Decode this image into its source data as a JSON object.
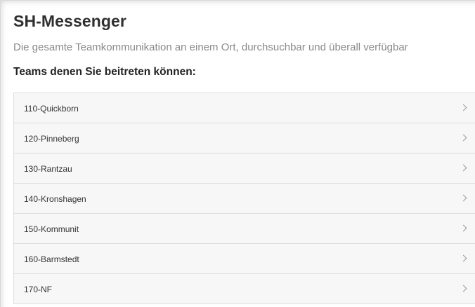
{
  "app": {
    "title": "SH-Messenger",
    "subtitle": "Die gesamte Teamkommunikation an einem Ort, durchsuchbar und überall verfügbar"
  },
  "teams_section": {
    "heading": "Teams denen Sie beitreten können:",
    "items": [
      {
        "label": "110-Quickborn",
        "icon": "chevron-right-icon"
      },
      {
        "label": "120-Pinneberg",
        "icon": "chevron-right-icon"
      },
      {
        "label": "130-Rantzau",
        "icon": "chevron-right-icon"
      },
      {
        "label": "140-Kronshagen",
        "icon": "chevron-right-icon"
      },
      {
        "label": "150-Kommunit",
        "icon": "chevron-right-icon"
      },
      {
        "label": "160-Barmstedt",
        "icon": "chevron-right-icon"
      },
      {
        "label": "170-NF",
        "icon": "chevron-right-icon"
      }
    ]
  },
  "colors": {
    "title_text": "#2f2f2f",
    "subtitle_text": "#8a8a8a",
    "row_background": "#f7f7f7",
    "row_border": "#dddddd",
    "chevron": "#9a9a9a"
  }
}
